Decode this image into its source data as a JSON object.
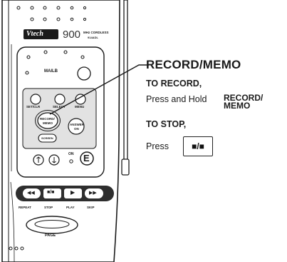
{
  "phone": {
    "brand": "Vtech",
    "model": "900",
    "band": "MHz CORDLESS",
    "model_code": "914ADL",
    "mailbox_label": "MAILB",
    "buttons": {
      "setclr": "SET/CLR",
      "select": "SELECT",
      "menu": "MENU",
      "record_memo_line1": "RECORD/",
      "record_memo_line2": "MEMO",
      "answer_on_line1": "ANSWER",
      "answer_on_line2": "ON",
      "screen": "SCREEN",
      "on": "ON",
      "e": "E",
      "page": "PAGE"
    },
    "transport_labels": [
      "REPEAT",
      "STOP",
      "PLAY",
      "SKIP"
    ],
    "transport_glyphs": [
      "◀◀",
      "■/■",
      "▶",
      "▶▶"
    ]
  },
  "instructions": {
    "title": "RECORD/MEMO",
    "to_record": "TO RECORD,",
    "press_and_hold": "Press and Hold",
    "button_name_line1": "RECORD/",
    "button_name_line2": "MEMO",
    "to_stop": "TO STOP,",
    "press": "Press",
    "stop_glyph": "■/■"
  },
  "colors": {
    "ink": "#1a1a1a",
    "panel": "#e2e2e2",
    "button_dark": "#333333"
  }
}
